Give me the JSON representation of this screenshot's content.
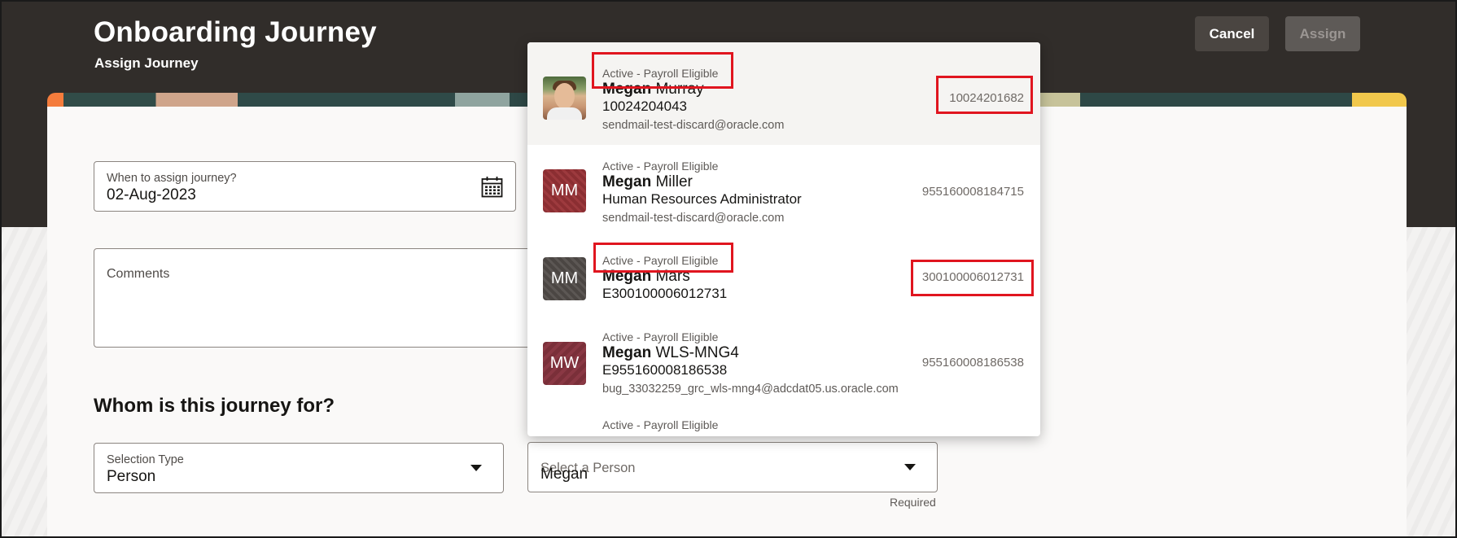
{
  "header": {
    "title": "Onboarding Journey",
    "subtitle": "Assign Journey",
    "cancel_label": "Cancel",
    "assign_label": "Assign"
  },
  "form": {
    "date": {
      "label": "When to assign journey?",
      "value": "02-Aug-2023",
      "icon": "calendar-icon"
    },
    "comments": {
      "label": "Comments",
      "value": ""
    },
    "section_title": "Whom is this journey for?",
    "selection_type": {
      "label": "Selection Type",
      "value": "Person"
    },
    "person": {
      "placeholder": "Select a Person",
      "value": "Megan",
      "required_note": "Required"
    }
  },
  "dropdown": {
    "items": [
      {
        "status": "Active - Payroll Eligible",
        "first": "Megan",
        "last": "Murray",
        "line": "10024204043",
        "email": "sendmail-test-discard@oracle.com",
        "id": "10024201682",
        "avatar": "photo"
      },
      {
        "status": "Active - Payroll Eligible",
        "first": "Megan",
        "last": "Miller",
        "line": "Human Resources Administrator",
        "email": "sendmail-test-discard@oracle.com",
        "id": "955160008184715",
        "avatar": "MM"
      },
      {
        "status": "Active - Payroll Eligible",
        "first": "Megan",
        "last": "Mars",
        "line": "E300100006012731",
        "email": "",
        "id": "300100006012731",
        "avatar": "MM"
      },
      {
        "status": "Active - Payroll Eligible",
        "first": "Megan",
        "last": "WLS-MNG4",
        "line": "E955160008186538",
        "email": "bug_33032259_grc_wls-mng4@adcdat05.us.oracle.com",
        "id": "955160008186538",
        "avatar": "MW"
      },
      {
        "status": "Active - Payroll Eligible"
      }
    ]
  },
  "colors": {
    "header_bg": "#312d2a",
    "highlight_box": "#e0151f",
    "avatar_red": "#8b2e32",
    "avatar_dark": "#4b4643",
    "avatar_wine": "#7a2f39"
  }
}
